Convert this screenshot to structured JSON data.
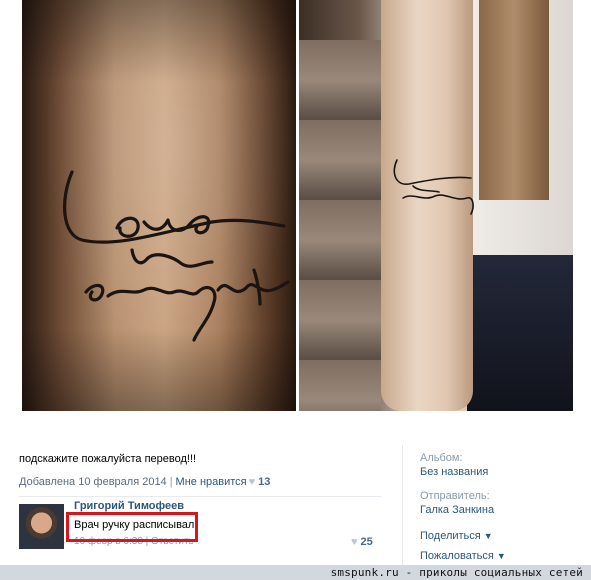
{
  "photo_left": {
    "alt": "tattoo-close-up"
  },
  "photo_right": {
    "alt": "tattoo-on-arm"
  },
  "post": {
    "caption": "подскажите пожалуйста перевод!!!",
    "added": "Добавлена 10 февраля 2014",
    "like_label": "Мне нравится",
    "like_count": "13"
  },
  "comment": {
    "author": "Григорий Тимофеев",
    "text": "Врач ручку расписывал",
    "date": "10 февр в 6:38 | Ответить",
    "likes": "25"
  },
  "sidebar": {
    "album_label": "Альбом:",
    "album_value": "Без названия",
    "sender_label": "Отправитель:",
    "sender_value": "Галка Занкина",
    "share": "Поделиться",
    "report": "Пожаловаться"
  },
  "footer": {
    "watermark": "smspunk.ru - приколы социальных сетей"
  },
  "colors": {
    "link": "#2b587a",
    "highlight": "#d4171d",
    "muted": "#8a9aad"
  }
}
